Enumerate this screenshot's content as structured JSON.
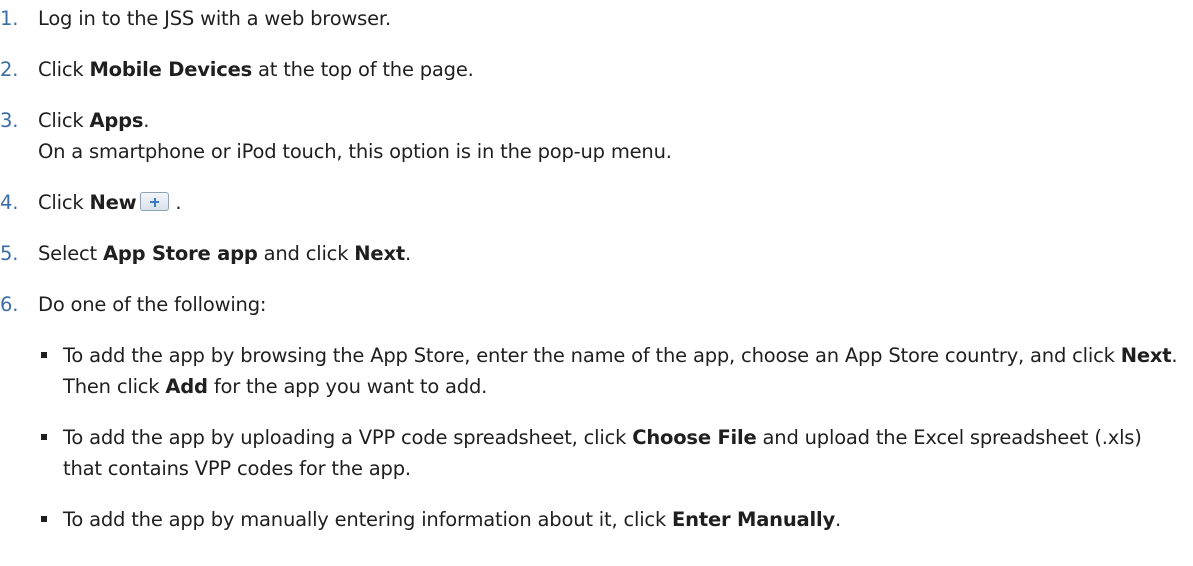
{
  "steps": [
    {
      "num": "1.",
      "pre": "Log in to the JSS with a web browser.",
      "bold": "",
      "post": ""
    },
    {
      "num": "2.",
      "pre": "Click ",
      "bold": "Mobile Devices",
      "post": " at the top of the page."
    },
    {
      "num": "3.",
      "pre": "Click ",
      "bold": "Apps",
      "post": ".",
      "note": "On a smartphone or iPod touch, this option is in the pop-up menu."
    },
    {
      "num": "4.",
      "pre": "Click ",
      "bold": "New",
      "post": " .",
      "icon": "plus-icon"
    },
    {
      "num": "5.",
      "pre": "Select ",
      "bold": "App Store app",
      "mid": " and click ",
      "bold2": "Next",
      "post": "."
    },
    {
      "num": "6.",
      "pre": "Do one of the following:",
      "bold": "",
      "post": ""
    }
  ],
  "options": [
    {
      "a": "To add the app by browsing the App Store, enter the name of the app, choose an App Store country, and click ",
      "b1": "Next",
      "c": ". Then click ",
      "b2": "Add",
      "d": " for the app you want to add."
    },
    {
      "a": "To add the app by uploading a VPP code spreadsheet, click ",
      "b1": "Choose File",
      "c": " and upload the Excel spreadsheet (.xls) that contains VPP codes for the app."
    },
    {
      "a": "To add the app by manually entering information about it, click ",
      "b1": "Enter Manually",
      "c": "."
    }
  ]
}
